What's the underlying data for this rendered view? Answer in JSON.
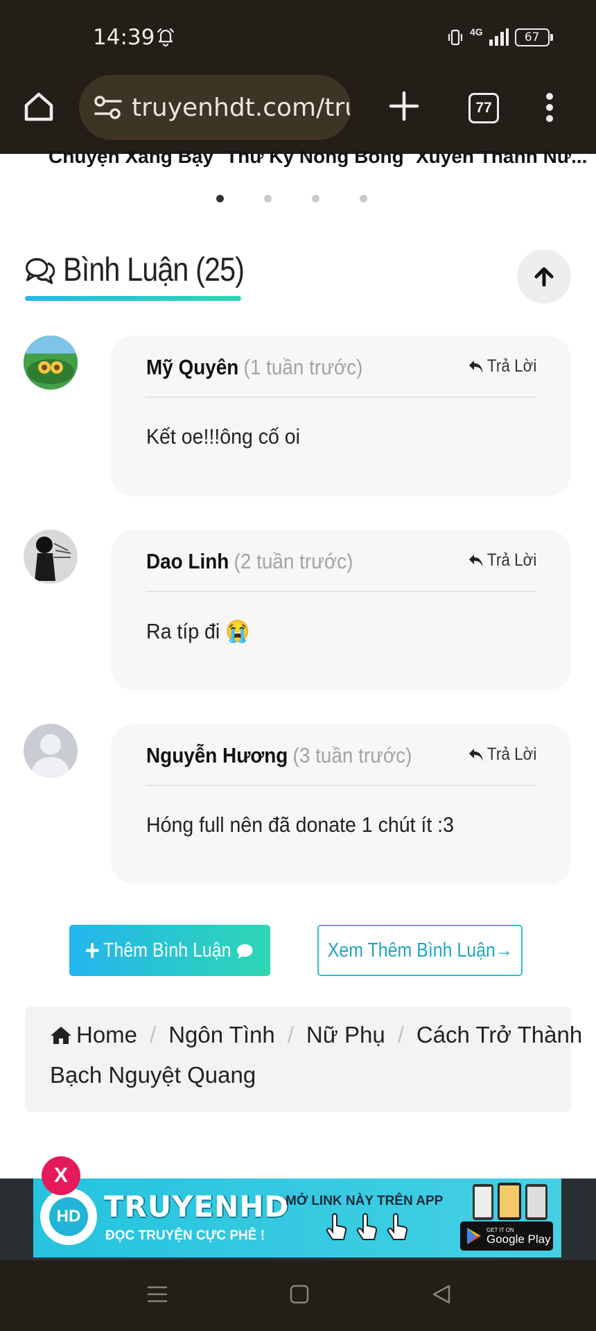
{
  "status_bar": {
    "time": "14:39",
    "network": "4G",
    "battery": "67"
  },
  "browser": {
    "url": "truyenhdt.com/tru",
    "tab_count": "77"
  },
  "carousel": {
    "titles": [
      "Chuyện Xàng Bậy",
      "Thư Ký Nóng Bỏng",
      "Xuyên Thành Nữ..."
    ],
    "dots": 4,
    "active_dot": 0
  },
  "comments_section": {
    "title": "Bình Luận (25)",
    "comments": [
      {
        "name": "Mỹ Quyên",
        "time": "(1 tuần trước)",
        "reply_label": "Trả Lời",
        "text": "Kết oe!!!ông cố oi"
      },
      {
        "name": "Dao Linh",
        "time": "(2 tuần trước)",
        "reply_label": "Trả Lời",
        "text": "Ra típ đi 😭"
      },
      {
        "name": "Nguyễn Hương",
        "time": "(3 tuần trước)",
        "reply_label": "Trả Lời",
        "text": "Hóng full nên đã donate 1 chút ít :3"
      }
    ],
    "add_comment_label": "Thêm Bình Luận",
    "more_comments_label": "Xem Thêm Bình Luận→"
  },
  "breadcrumb": {
    "items": [
      "Home",
      "Ngôn Tình",
      "Nữ Phụ",
      "Cách Trở Thành"
    ],
    "continuation": "Bạch Nguyệt Quang"
  },
  "ad_banner": {
    "close_label": "X",
    "logo_text": "HD",
    "brand": "TRUYENHD",
    "tagline": "ĐỌC TRUYỆN CỰC PHÊ !",
    "cta": "MỞ LINK NÀY TRÊN APP",
    "store_small": "GET IT ON",
    "store_name": "Google Play"
  },
  "colors": {
    "accent_start": "#24b5ee",
    "accent_end": "#2fd6b4",
    "ad_close": "#e6195a",
    "chrome": "#231e17"
  }
}
